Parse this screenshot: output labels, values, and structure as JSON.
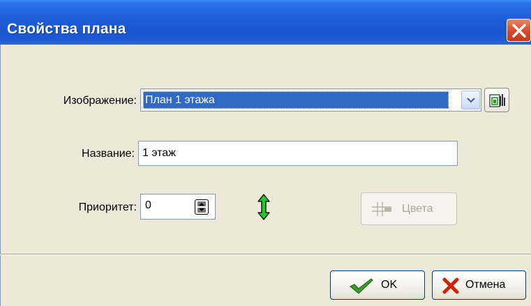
{
  "window": {
    "title": "Свойства плана"
  },
  "form": {
    "image_label": "Изображение:",
    "image_value": "План 1 этажа",
    "name_label": "Название:",
    "name_value": "1 этаж",
    "priority_label": "Приоритет:",
    "priority_value": "0",
    "colors_button": "Цвета"
  },
  "buttons": {
    "ok": "OK",
    "cancel": "Отмена"
  },
  "icons": {
    "close": "close-icon",
    "dropdown": "chevron-down-icon",
    "picker": "image-picker-icon",
    "spin": "spin-updown-icon",
    "arrow": "vertical-double-arrow-icon",
    "colors": "grid-icon",
    "ok": "checkmark-icon",
    "cancel": "cross-icon"
  },
  "colors": {
    "selection": "#316ac5",
    "titlebar": "#1f5fd8",
    "arrow": "#22c922",
    "cancel_x": "#cc2200",
    "ok_check": "#3a9a2a"
  }
}
